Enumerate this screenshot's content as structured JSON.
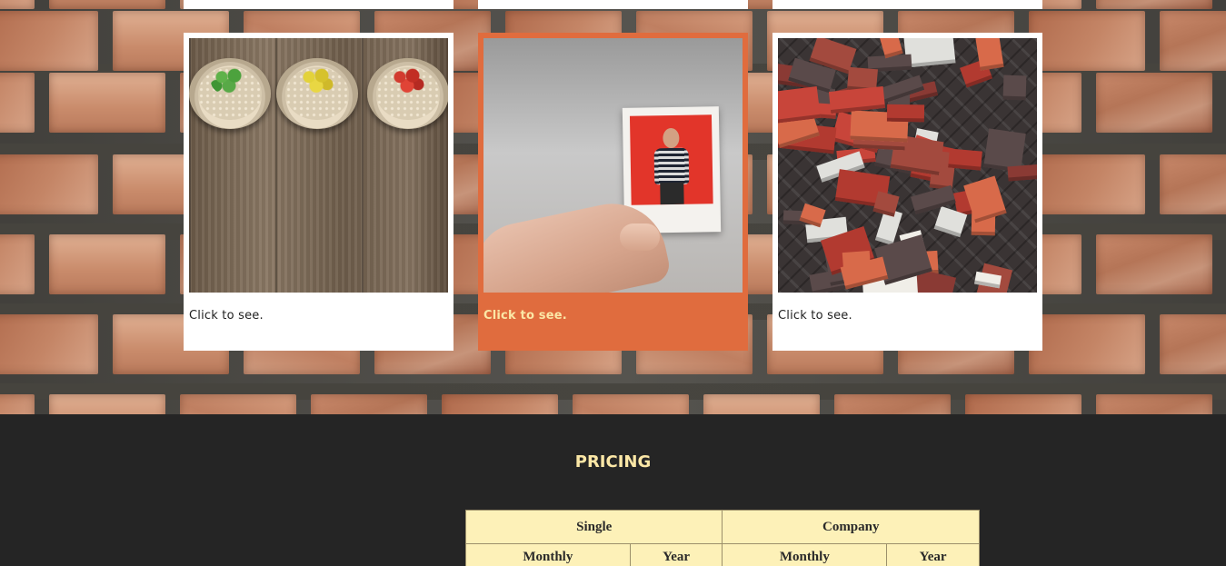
{
  "gallery": {
    "cards": [
      {
        "caption": "Click to see.",
        "state": "default",
        "photo": "succulent-bowls-on-wood"
      },
      {
        "caption": "Click to see.",
        "state": "hover",
        "photo": "hand-holding-polaroid"
      },
      {
        "caption": "Click to see.",
        "state": "default",
        "photo": "aerial-town-rooftops"
      }
    ],
    "accent_color": "#e06c3e"
  },
  "pricing": {
    "title": "PRICING",
    "groups": [
      "Single",
      "Company"
    ],
    "periods": [
      "Monthly",
      "Year",
      "Monthly",
      "Year"
    ],
    "table_color": "#fdf1b8"
  }
}
